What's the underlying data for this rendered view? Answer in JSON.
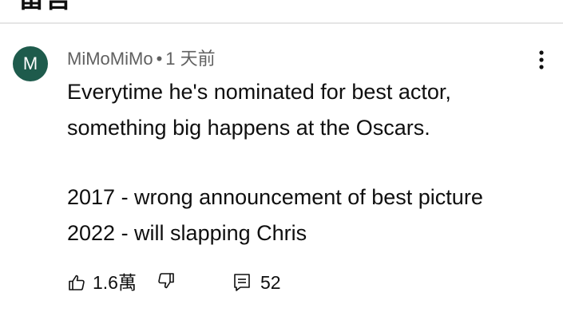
{
  "header": {
    "title": "留言"
  },
  "comment": {
    "avatar_letter": "M",
    "avatar_color": "#1e5b4c",
    "author": "MiMoMiMo",
    "separator": "•",
    "timestamp": "1 天前",
    "body_lines": [
      "Everytime he's nominated for best actor,",
      "something big happens at the Oscars.",
      "",
      "2017 - wrong announcement of best picture",
      "2022 - will slapping Chris"
    ],
    "like_count": "1.6萬",
    "reply_count": "52",
    "more_icon": "vertical-dots-icon",
    "like_icon": "thumbs-up-icon",
    "dislike_icon": "thumbs-down-icon",
    "reply_icon": "reply-comment-icon"
  }
}
